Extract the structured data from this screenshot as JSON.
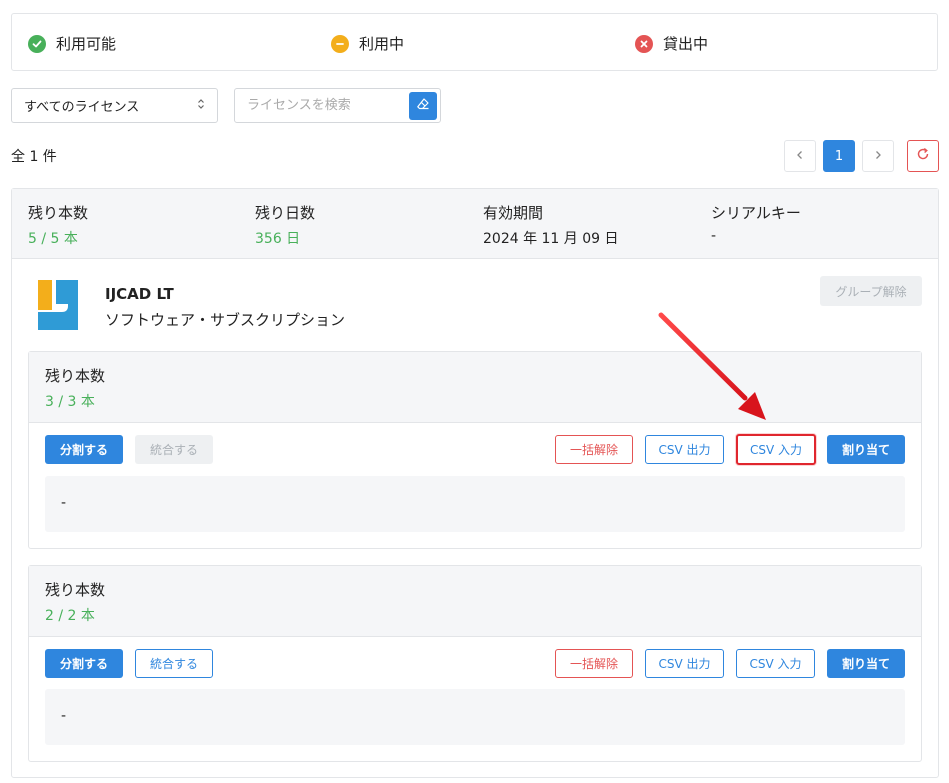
{
  "legend": {
    "available": "利用可能",
    "in_use": "利用中",
    "lent": "貸出中"
  },
  "filter": {
    "select_value": "すべてのライセンス",
    "search_placeholder": "ライセンスを検索"
  },
  "total_label": "全 1 件",
  "pagination": {
    "current": "1"
  },
  "summary": {
    "remaining_label": "残り本数",
    "remaining_value": "5 / 5 本",
    "days_label": "残り日数",
    "days_value": "356 日",
    "validity_label": "有効期間",
    "validity_value": "2024 年 11 月 09 日",
    "serial_label": "シリアルキー",
    "serial_value": "-"
  },
  "product": {
    "name": "IJCAD LT",
    "type": "ソフトウェア・サブスクリプション",
    "ungroup_label": "グループ解除"
  },
  "groups": [
    {
      "label": "残り本数",
      "value": "3 / 3 本",
      "split": "分割する",
      "merge": "統合する",
      "bulk_release": "一括解除",
      "csv_out": "CSV 出力",
      "csv_in": "CSV 入力",
      "assign": "割り当て",
      "detail": "-"
    },
    {
      "label": "残り本数",
      "value": "2 / 2 本",
      "split": "分割する",
      "merge": "統合する",
      "bulk_release": "一括解除",
      "csv_out": "CSV 出力",
      "csv_in": "CSV 入力",
      "assign": "割り当て",
      "detail": "-"
    }
  ],
  "colors": {
    "primary": "#2f86de",
    "success": "#48b05a",
    "warning": "#f3ae1b",
    "danger": "#e45454",
    "annotation_arrow": "#e0262e"
  }
}
